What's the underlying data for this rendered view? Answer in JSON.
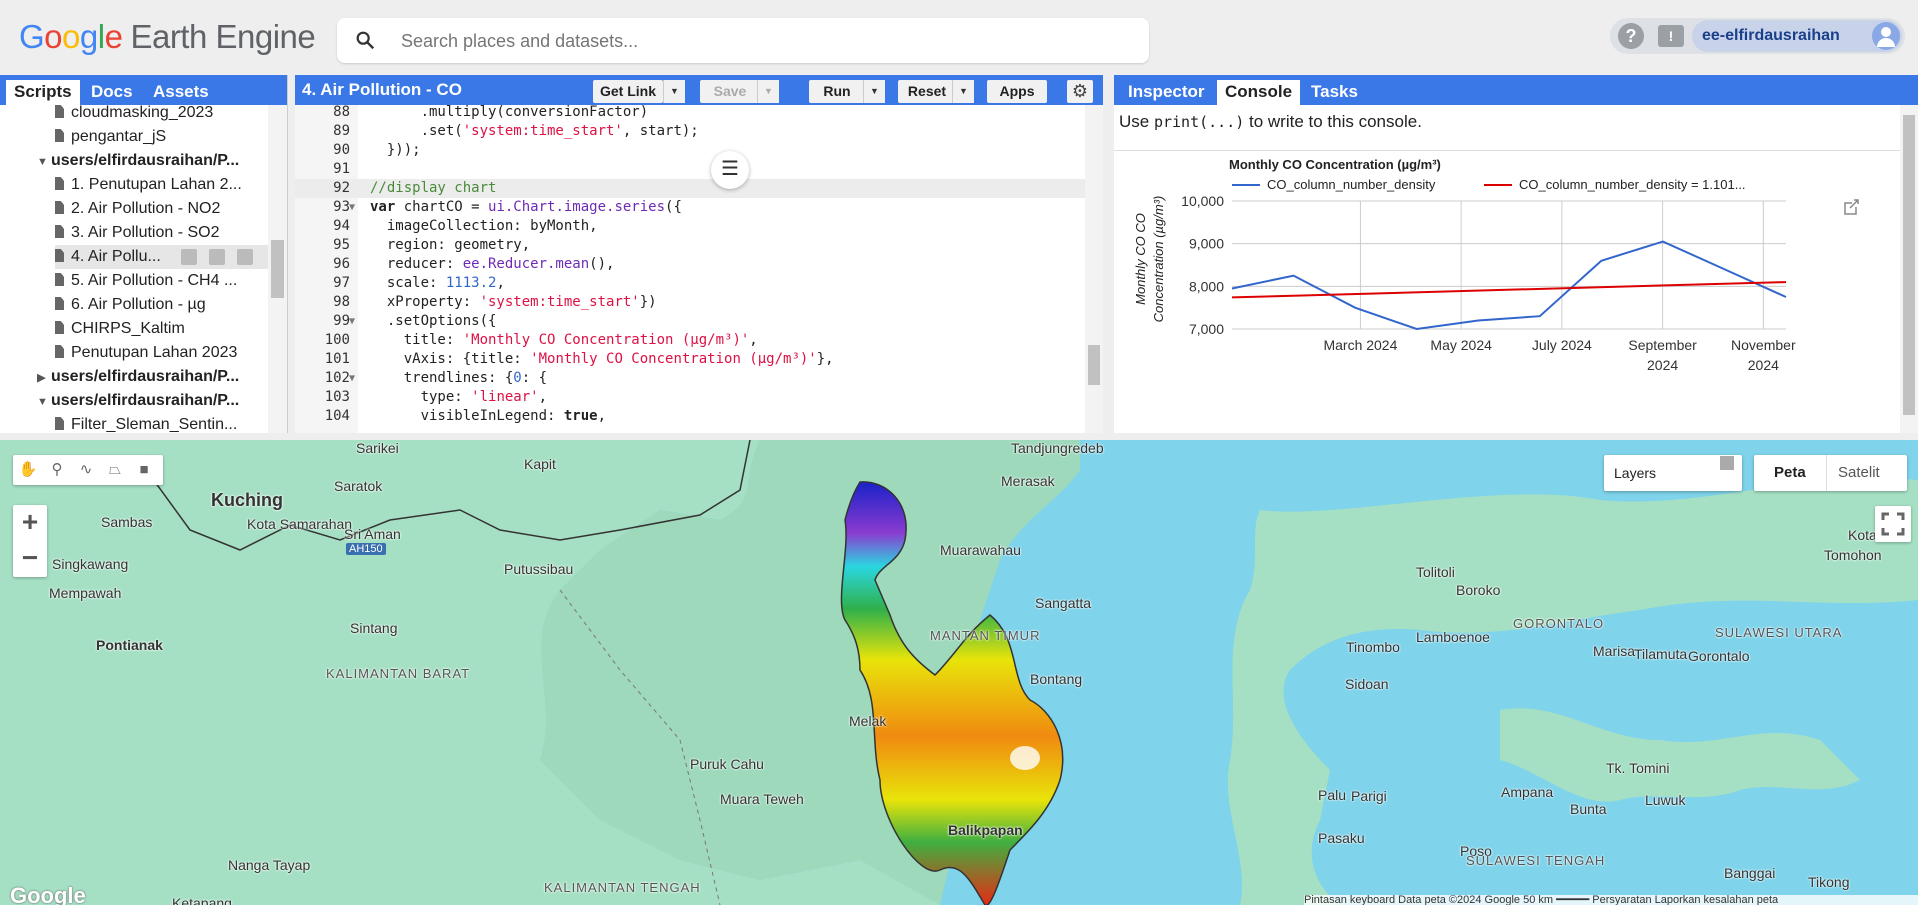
{
  "app": {
    "logo_google": "Google",
    "logo_product": "Earth Engine",
    "search_placeholder": "Search places and datasets...",
    "help": "?",
    "feedback": "!",
    "user": "ee-elfirdausraihan"
  },
  "left_panel": {
    "tabs": [
      "Scripts",
      "Docs",
      "Assets"
    ],
    "active_tab": "Scripts",
    "tree": [
      {
        "label": "cloudmasking_2023",
        "type": "file"
      },
      {
        "label": "pengantar_jS",
        "type": "file"
      },
      {
        "label": "users/elfirdausraihan/P...",
        "type": "folder",
        "expanded": true
      },
      {
        "label": "1. Penutupan Lahan 2...",
        "type": "file"
      },
      {
        "label": "2. Air Pollution - NO2",
        "type": "file"
      },
      {
        "label": "3. Air Pollution - SO2",
        "type": "file"
      },
      {
        "label": "4. Air Pollu...",
        "type": "file",
        "selected": true
      },
      {
        "label": "5. Air Pollution - CH4 ...",
        "type": "file"
      },
      {
        "label": "6. Air Pollution - µg",
        "type": "file"
      },
      {
        "label": "CHIRPS_Kaltim",
        "type": "file"
      },
      {
        "label": "Penutupan Lahan 2023",
        "type": "file"
      },
      {
        "label": "users/elfirdausraihan/P...",
        "type": "folder",
        "expanded": false
      },
      {
        "label": "users/elfirdausraihan/P...",
        "type": "folder",
        "expanded": true
      },
      {
        "label": "Filter_Sleman_Sentin...",
        "type": "file"
      }
    ]
  },
  "editor": {
    "title": "4. Air Pollution - CO",
    "buttons": {
      "get_link": "Get Link",
      "save": "Save",
      "run": "Run",
      "reset": "Reset",
      "apps": "Apps"
    },
    "lines": [
      {
        "n": "88",
        "html": "      .multiply(conversionFactor)"
      },
      {
        "n": "89",
        "html": "      .set(<span class='str'>'system:time_start'</span>, start);"
      },
      {
        "n": "90",
        "html": "  }));"
      },
      {
        "n": "91",
        "html": ""
      },
      {
        "n": "92",
        "html": "<span class='cm'>//display chart</span>",
        "hl": true
      },
      {
        "n": "93",
        "html": "<span class='kw'>var</span> chartCO = <span class='fn'>ui.Chart.image.series</span>({",
        "fold": true
      },
      {
        "n": "94",
        "html": "  imageCollection: byMonth,"
      },
      {
        "n": "95",
        "html": "  region: geometry,"
      },
      {
        "n": "96",
        "html": "  reducer: <span class='fn'>ee.Reducer.mean</span>(),"
      },
      {
        "n": "97",
        "html": "  scale: <span class='num'>1113.2</span>,"
      },
      {
        "n": "98",
        "html": "  xProperty: <span class='str'>'system:time_start'</span>})"
      },
      {
        "n": "99",
        "html": "  .setOptions({",
        "fold": true
      },
      {
        "n": "100",
        "html": "    title: <span class='str'>'Monthly CO Concentration (µg/m³)'</span>,"
      },
      {
        "n": "101",
        "html": "    vAxis: {title: <span class='str'>'Monthly CO Concentration (µg/m³)'</span>},"
      },
      {
        "n": "102",
        "html": "    trendlines: {<span class='num'>0</span>: {",
        "fold": true
      },
      {
        "n": "103",
        "html": "      type: <span class='str'>'linear'</span>,"
      },
      {
        "n": "104",
        "html": "      visibleInLegend: <span class='kw'>true</span>,"
      }
    ]
  },
  "right_panel": {
    "tabs": [
      "Inspector",
      "Console",
      "Tasks"
    ],
    "active_tab": "Console",
    "hint_pre": "Use ",
    "hint_code": "print(...)",
    "hint_post": " to write to this console."
  },
  "chart_data": {
    "type": "line",
    "title": "Monthly CO Concentration (µg/m³)",
    "ylabel": "Monthly CO Concentration (µg/m³)",
    "xlabel": "",
    "x": [
      "2024-01",
      "2024-02",
      "2024-03",
      "2024-04",
      "2024-05",
      "2024-06",
      "2024-07",
      "2024-08",
      "2024-09",
      "2024-10",
      "2024-11",
      "2024-12"
    ],
    "x_tick_labels": [
      [
        "March 2024"
      ],
      [
        "May 2024"
      ],
      [
        "July 2024"
      ],
      [
        "September",
        "2024"
      ],
      [
        "November",
        "2024"
      ]
    ],
    "x_tick_indices": [
      2,
      4,
      6,
      8,
      10
    ],
    "ylim": [
      7000,
      10000
    ],
    "y_ticks": [
      "10,000",
      "9,000",
      "8,000",
      "7,000"
    ],
    "series": [
      {
        "name": "CO_column_number_density",
        "color": "#3366cc",
        "values": [
          7950,
          8250,
          7500,
          7000,
          7200,
          7300,
          8600,
          9050,
          8400,
          7750
        ]
      },
      {
        "name": "CO_column_number_density = 1.101...",
        "color": "#dc0000",
        "values": [
          7740,
          8100
        ]
      }
    ],
    "grid": true,
    "legend": "top"
  },
  "map": {
    "labels": [
      {
        "t": "Sarikei"
      },
      {
        "t": "Kapit"
      },
      {
        "t": "Tandjungredeb"
      },
      {
        "t": "Kuching"
      },
      {
        "t": "Saratok"
      },
      {
        "t": "Merasak"
      },
      {
        "t": "Sambas"
      },
      {
        "t": "Kota Samarahan"
      },
      {
        "t": "Sri Aman"
      },
      {
        "t": "AH150"
      },
      {
        "t": "Muarawahau"
      },
      {
        "t": "Singkawang"
      },
      {
        "t": "Putussibau"
      },
      {
        "t": "Mempawah"
      },
      {
        "t": "Sintang"
      },
      {
        "t": "Pontianak"
      },
      {
        "t": "KALIMANTAN BARAT"
      },
      {
        "t": "Melak"
      },
      {
        "t": "Puruk Cahu"
      },
      {
        "t": "Muara Teweh"
      },
      {
        "t": "Nanga Tayap"
      },
      {
        "t": "KALIMANTAN TENGAH"
      },
      {
        "t": "Ketapang"
      },
      {
        "t": "Sangatta"
      },
      {
        "t": "Bontang"
      },
      {
        "t": "Balikpapan"
      },
      {
        "t": "Tolitoli"
      },
      {
        "t": "Boroko"
      },
      {
        "t": "GORONTALO"
      },
      {
        "t": "Tinombo"
      },
      {
        "t": "Lamboenoe"
      },
      {
        "t": "SULAWESI UTARA"
      },
      {
        "t": "Marisa"
      },
      {
        "t": "Tilamuta"
      },
      {
        "t": "Gorontalo"
      },
      {
        "t": "Sidoan"
      },
      {
        "t": "Tk. Tomini"
      },
      {
        "t": "Palu"
      },
      {
        "t": "Parigi"
      },
      {
        "t": "Ampana"
      },
      {
        "t": "Luwuk"
      },
      {
        "t": "Bunta"
      },
      {
        "t": "Pasaku"
      },
      {
        "t": "Poso"
      },
      {
        "t": "SULAWESI TENGAH"
      },
      {
        "t": "Banggai"
      },
      {
        "t": "Tikong"
      },
      {
        "t": "Tomohon"
      },
      {
        "t": "Kota"
      },
      {
        "t": "MANTAN TIMUR"
      }
    ],
    "layers_label": "Layers",
    "maptype": [
      "Peta",
      "Satelit"
    ],
    "attribution": "Pintasan keyboard   Data peta ©2024 Google   50 km ━━━━━   Persyaratan   Laporkan kesalahan peta",
    "google": "Google",
    "zoom_in": "+",
    "zoom_out": "−"
  }
}
